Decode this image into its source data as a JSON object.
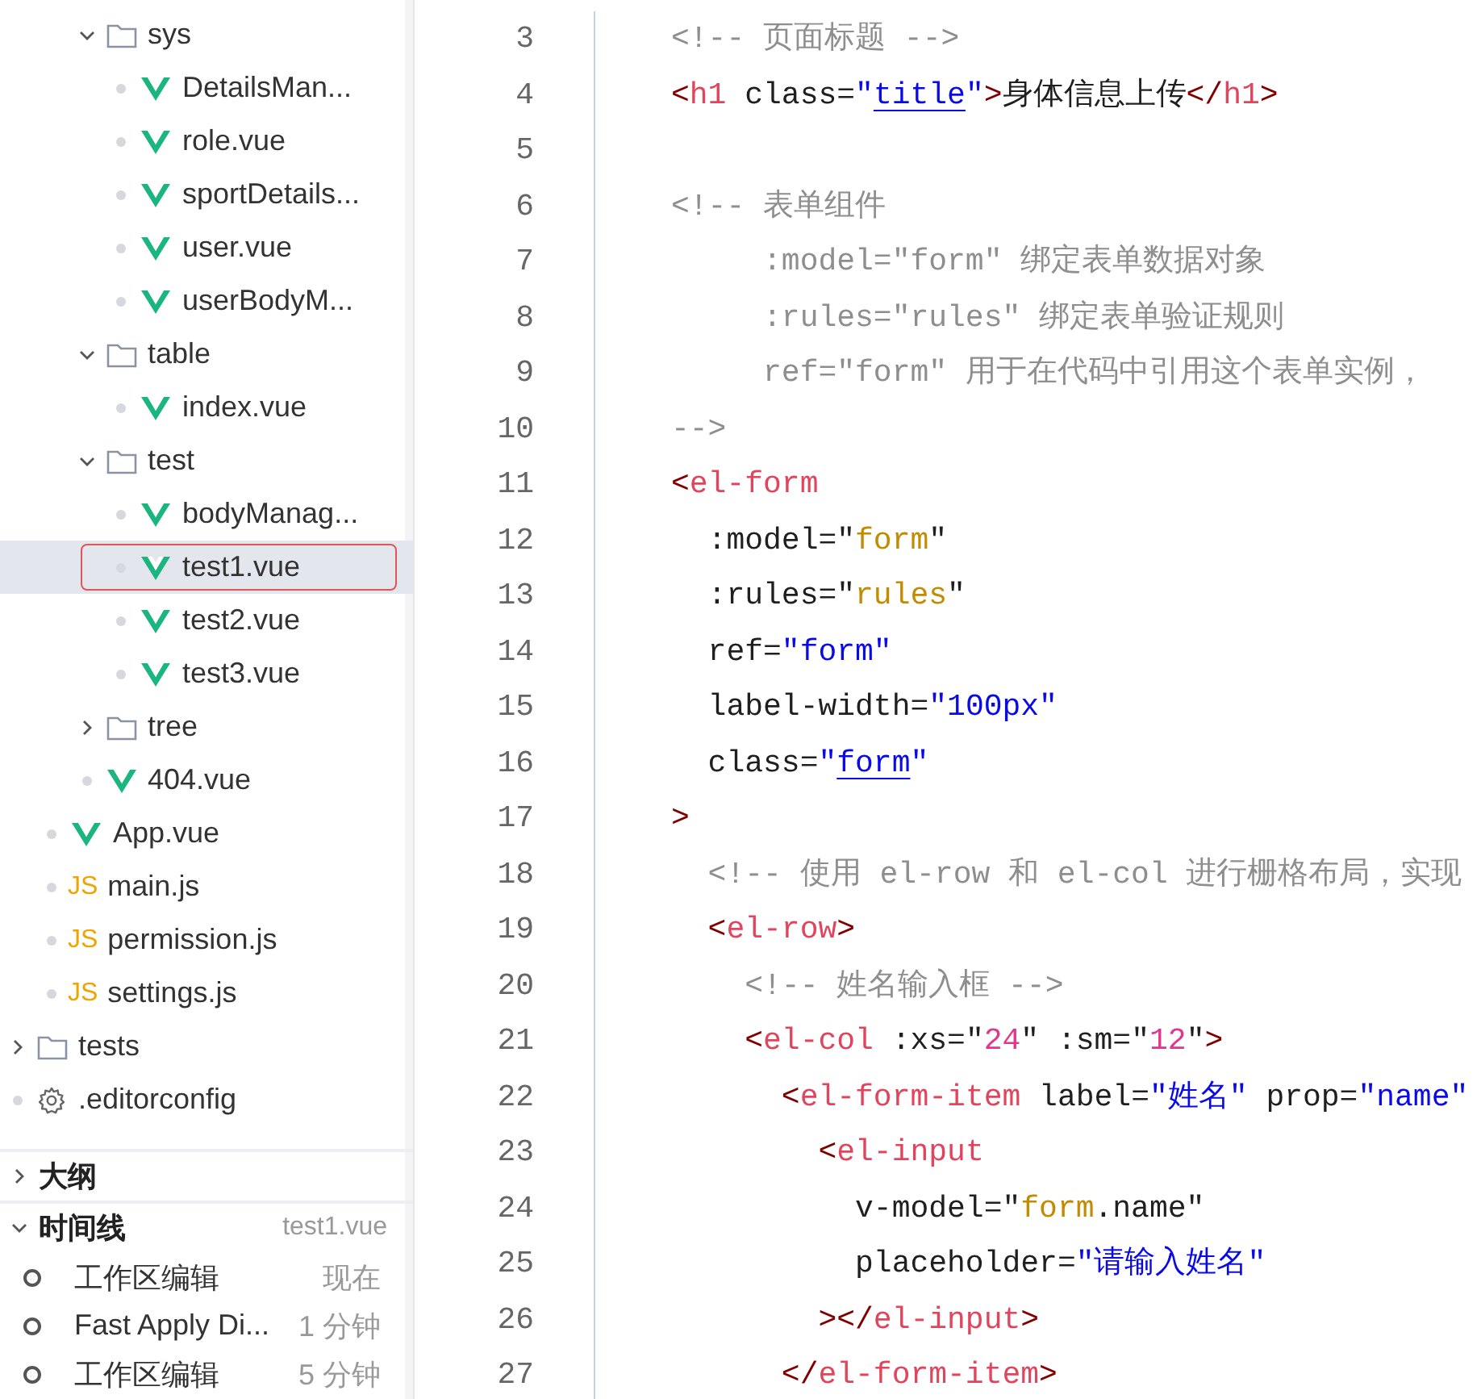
{
  "explorer": {
    "tree": [
      {
        "children": [
          {
            "children": [
              {
                "kind": "folder",
                "label": "sys",
                "expanded": true,
                "selected": false,
                "children": [
                  {
                    "kind": "vue",
                    "label": "DetailsMan...",
                    "selected": false
                  },
                  {
                    "kind": "vue",
                    "label": "role.vue",
                    "selected": false
                  },
                  {
                    "kind": "vue",
                    "label": "sportDetails...",
                    "selected": false
                  },
                  {
                    "kind": "vue",
                    "label": "user.vue",
                    "selected": false
                  },
                  {
                    "kind": "vue",
                    "label": "userBodyM...",
                    "selected": false
                  }
                ]
              },
              {
                "kind": "folder",
                "label": "table",
                "expanded": true,
                "selected": false,
                "children": [
                  {
                    "kind": "vue",
                    "label": "index.vue",
                    "selected": false
                  }
                ]
              },
              {
                "kind": "folder",
                "label": "test",
                "expanded": true,
                "selected": false,
                "children": [
                  {
                    "kind": "vue",
                    "label": "bodyManag...",
                    "selected": false
                  },
                  {
                    "kind": "vue",
                    "label": "test1.vue",
                    "selected": true
                  },
                  {
                    "kind": "vue",
                    "label": "test2.vue",
                    "selected": false
                  },
                  {
                    "kind": "vue",
                    "label": "test3.vue",
                    "selected": false
                  }
                ]
              },
              {
                "kind": "folder",
                "label": "tree",
                "expanded": false,
                "selected": false
              },
              {
                "kind": "vue",
                "label": "404.vue",
                "selected": false
              }
            ]
          },
          {
            "kind": "vue",
            "label": "App.vue",
            "selected": false
          },
          {
            "kind": "js",
            "badge": "JS",
            "label": "main.js",
            "selected": false
          },
          {
            "kind": "js",
            "badge": "JS",
            "label": "permission.js",
            "selected": false
          },
          {
            "kind": "js",
            "badge": "JS",
            "label": "settings.js",
            "selected": false
          }
        ]
      },
      {
        "kind": "folder",
        "label": "tests",
        "expanded": false,
        "selected": false
      },
      {
        "kind": "config",
        "label": ".editorconfig",
        "selected": false
      }
    ]
  },
  "outline": {
    "title": "大纲",
    "expanded": false
  },
  "timeline": {
    "title": "时间线",
    "expanded": true,
    "file": "test1.vue",
    "entries": [
      {
        "label": "工作区编辑",
        "time": "现在"
      },
      {
        "label": "Fast Apply Di...",
        "time": "1 分钟"
      },
      {
        "label": "工作区编辑",
        "time": "5 分钟"
      }
    ]
  },
  "editor": {
    "lines": [
      {
        "number": "3",
        "tokens": [
          {
            "kind": "comment",
            "text": "<!-- 页面标题 -->"
          }
        ]
      },
      {
        "number": "4",
        "tokens": [
          {
            "kind": "punct",
            "text": "<"
          },
          {
            "kind": "tag",
            "text": "h1"
          },
          {
            "kind": "attr",
            "text": " class="
          },
          {
            "kind": "string",
            "text": "\""
          },
          {
            "kind": "link",
            "text": "title"
          },
          {
            "kind": "string",
            "text": "\""
          },
          {
            "kind": "punct",
            "text": ">"
          },
          {
            "kind": "attr",
            "text": "身体信息上传"
          },
          {
            "kind": "punct",
            "text": "</"
          },
          {
            "kind": "tag",
            "text": "h1"
          },
          {
            "kind": "punct",
            "text": ">"
          }
        ]
      },
      {
        "number": "5"
      },
      {
        "number": "6",
        "tokens": [
          {
            "kind": "comment",
            "text": "<!-- 表单组件"
          }
        ]
      },
      {
        "number": "7",
        "tokens": [
          {
            "kind": "comment",
            "text": "     :model=\"form\" 绑定表单数据对象"
          }
        ]
      },
      {
        "number": "8",
        "tokens": [
          {
            "kind": "comment",
            "text": "     :rules=\"rules\" 绑定表单验证规则"
          }
        ]
      },
      {
        "number": "9",
        "tokens": [
          {
            "kind": "comment",
            "text": "     ref=\"form\" 用于在代码中引用这个表单实例，"
          }
        ]
      },
      {
        "number": "10",
        "tokens": [
          {
            "kind": "comment",
            "text": "-->"
          }
        ]
      },
      {
        "number": "11",
        "tokens": [
          {
            "kind": "punct",
            "text": "<"
          },
          {
            "kind": "tag",
            "text": "el-form"
          }
        ]
      },
      {
        "number": "12",
        "tokens": [
          {
            "kind": "attr",
            "text": "  :model=\""
          },
          {
            "kind": "var",
            "text": "form"
          },
          {
            "kind": "attr",
            "text": "\""
          }
        ]
      },
      {
        "number": "13",
        "tokens": [
          {
            "kind": "attr",
            "text": "  :rules=\""
          },
          {
            "kind": "var",
            "text": "rules"
          },
          {
            "kind": "attr",
            "text": "\""
          }
        ]
      },
      {
        "number": "14",
        "tokens": [
          {
            "kind": "attr",
            "text": "  ref="
          },
          {
            "kind": "string",
            "text": "\"form\""
          }
        ]
      },
      {
        "number": "15",
        "tokens": [
          {
            "kind": "attr",
            "text": "  label-width="
          },
          {
            "kind": "string",
            "text": "\"100px\""
          }
        ]
      },
      {
        "number": "16",
        "tokens": [
          {
            "kind": "attr",
            "text": "  class="
          },
          {
            "kind": "string",
            "text": "\""
          },
          {
            "kind": "link",
            "text": "form"
          },
          {
            "kind": "string",
            "text": "\""
          }
        ]
      },
      {
        "number": "17",
        "tokens": [
          {
            "kind": "punct",
            "text": ">"
          }
        ]
      },
      {
        "number": "18",
        "tokens": [
          {
            "kind": "comment",
            "text": "  <!-- 使用 el-row 和 el-col 进行栅格布局，实现"
          }
        ]
      },
      {
        "number": "19",
        "tokens": [
          {
            "kind": "punct",
            "text": "  <"
          },
          {
            "kind": "tag",
            "text": "el-row"
          },
          {
            "kind": "punct",
            "text": ">"
          }
        ]
      },
      {
        "number": "20",
        "tokens": [
          {
            "kind": "comment",
            "text": "    <!-- 姓名输入框 -->"
          }
        ]
      },
      {
        "number": "21",
        "tokens": [
          {
            "kind": "punct",
            "text": "    <"
          },
          {
            "kind": "tag",
            "text": "el-col"
          },
          {
            "kind": "attr",
            "text": " :xs=\""
          },
          {
            "kind": "number",
            "text": "24"
          },
          {
            "kind": "attr",
            "text": "\" :sm=\""
          },
          {
            "kind": "number",
            "text": "12"
          },
          {
            "kind": "attr",
            "text": "\""
          },
          {
            "kind": "punct",
            "text": ">"
          }
        ]
      },
      {
        "number": "22",
        "tokens": [
          {
            "kind": "punct",
            "text": "      <"
          },
          {
            "kind": "tag",
            "text": "el-form-item"
          },
          {
            "kind": "attr",
            "text": " label="
          },
          {
            "kind": "string",
            "text": "\"姓名\""
          },
          {
            "kind": "attr",
            "text": " prop="
          },
          {
            "kind": "string",
            "text": "\"name\""
          }
        ]
      },
      {
        "number": "23",
        "tokens": [
          {
            "kind": "punct",
            "text": "        <"
          },
          {
            "kind": "tag",
            "text": "el-input"
          }
        ]
      },
      {
        "number": "24",
        "tokens": [
          {
            "kind": "attr",
            "text": "          v-model=\""
          },
          {
            "kind": "var",
            "text": "form"
          },
          {
            "kind": "attr",
            "text": ".name\""
          }
        ]
      },
      {
        "number": "25",
        "tokens": [
          {
            "kind": "attr",
            "text": "          placeholder="
          },
          {
            "kind": "string",
            "text": "\"请输入姓名\""
          }
        ]
      },
      {
        "number": "26",
        "tokens": [
          {
            "kind": "punct",
            "text": "        ></"
          },
          {
            "kind": "tag",
            "text": "el-input"
          },
          {
            "kind": "punct",
            "text": ">"
          }
        ]
      },
      {
        "number": "27",
        "tokens": [
          {
            "kind": "punct",
            "text": "      </"
          },
          {
            "kind": "tag",
            "text": "el-form-item"
          },
          {
            "kind": "punct",
            "text": ">"
          }
        ]
      }
    ]
  }
}
